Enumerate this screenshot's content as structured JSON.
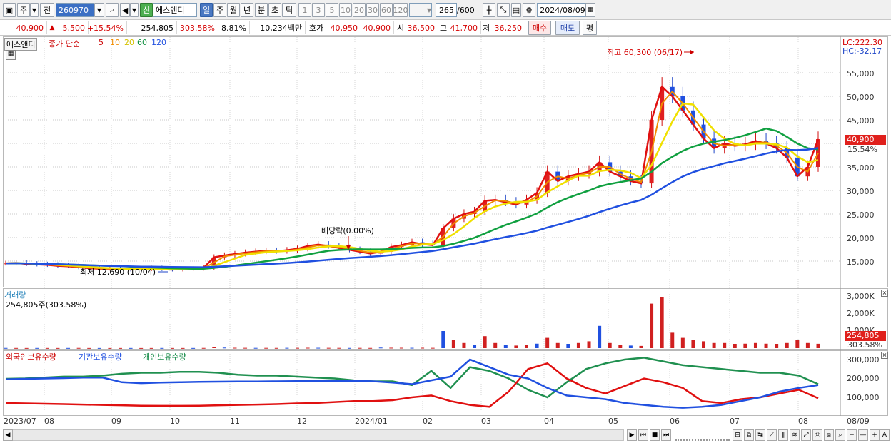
{
  "toolbar": {
    "period_type": "주",
    "all_label": "전",
    "code": "260970",
    "new_badge": "신",
    "name": "에스앤디",
    "tabs": [
      "일",
      "주",
      "월",
      "년",
      "분",
      "초",
      "틱"
    ],
    "selected_tab": "일",
    "intervals": [
      "1",
      "3",
      "5",
      "10",
      "20",
      "30",
      "60",
      "120"
    ],
    "count": "265",
    "count_max": "/600",
    "date": "2024/08/09"
  },
  "quote": {
    "price": "40,900",
    "change": "5,500",
    "change_pct": "+15.54%",
    "volume": "254,805",
    "volume_ratio": "303.58%",
    "turnover": "8.81%",
    "amount": "10,234백만",
    "ask_label": "호가",
    "ask1": "40,950",
    "ask2": "40,900",
    "open_label": "시",
    "open": "36,500",
    "high_label": "고",
    "high": "41,700",
    "low_label": "저",
    "low": "36,250",
    "buy": "매수",
    "sell": "매도",
    "eval": "평"
  },
  "chart_data": [
    {
      "type": "line",
      "title": "에스앤디",
      "series_legend": {
        "name": "종가 단순",
        "periods": [
          "5",
          "10",
          "20",
          "60",
          "120"
        ],
        "colors": [
          "#e01010",
          "#f08c00",
          "#f0e000",
          "#10a040",
          "#2050e0"
        ]
      },
      "x": [
        "2023/07",
        "08",
        "09",
        "10",
        "11",
        "12",
        "2024/01",
        "02",
        "03",
        "04",
        "05",
        "06",
        "07",
        "08",
        "08/09"
      ],
      "ylim": [
        10000,
        64000
      ],
      "y_ticks": [
        "15,000",
        "20,000",
        "25,000",
        "30,000",
        "35,000",
        "40,000",
        "45,000",
        "50,000",
        "55,000"
      ],
      "annotations": {
        "high": "최고 60,300 (06/17)",
        "low": "최저 12,690 (10/04)",
        "dividend": "배당락(0.00%)"
      },
      "lc": "LC:222.30",
      "hc": "HC:-32.17",
      "last_price": "40,900",
      "last_pct": "15.54%",
      "close_approx": [
        14500,
        14600,
        14400,
        14300,
        14200,
        14000,
        13900,
        13700,
        13500,
        13400,
        13400,
        13300,
        13200,
        13300,
        13500,
        13300,
        13200,
        13300,
        13400,
        13600,
        15800,
        16200,
        16500,
        16800,
        17000,
        17200,
        17100,
        17300,
        17600,
        18200,
        18500,
        18200,
        17800,
        17400,
        17000,
        16600,
        17000,
        18000,
        18400,
        19000,
        18600,
        18400,
        22000,
        24000,
        25000,
        25500,
        27800,
        28000,
        27500,
        27000,
        28000,
        29500,
        34000,
        32000,
        33000,
        33500,
        34000,
        36000,
        34000,
        33000,
        32000,
        31500,
        45000,
        52000,
        50000,
        47000,
        44000,
        41000,
        39000,
        40000,
        39500,
        39800,
        40500,
        40000,
        39000,
        37000,
        33000,
        35000,
        40900
      ]
    },
    {
      "type": "bar",
      "title": "거래량",
      "summary": "254,805주(303.58%)",
      "y_ticks": [
        "1,000K",
        "2,000K",
        "3,000K"
      ],
      "last_value": "254,805",
      "last_pct": "303.58%"
    },
    {
      "type": "line",
      "series": [
        {
          "name": "외국인보유수량",
          "color": "#e01010"
        },
        {
          "name": "기관보유수량",
          "color": "#2050e0"
        },
        {
          "name": "개인보유수량",
          "color": "#209050"
        }
      ],
      "y_ticks": [
        "100,000",
        "200,000",
        "300,000"
      ]
    }
  ]
}
